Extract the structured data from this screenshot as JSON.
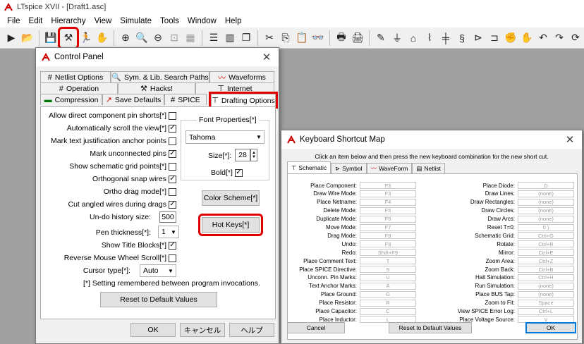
{
  "app": {
    "title": "LTspice XVII - [Draft1.asc]"
  },
  "menu": [
    "File",
    "Edit",
    "Hierarchy",
    "View",
    "Simulate",
    "Tools",
    "Window",
    "Help"
  ],
  "toolbar_icons": [
    "run-icon",
    "open-icon",
    "save-icon",
    "control-panel-icon",
    "running-man-icon",
    "hand-icon",
    "zoom-in-icon",
    "zoom-pan-icon",
    "zoom-out-icon",
    "zoom-fit-icon",
    "tile-horizontal-icon",
    "tile-vertical-icon",
    "cascade-icon",
    "cut-icon",
    "copy-icon",
    "paste-icon",
    "find-icon",
    "print-setup-icon",
    "print-icon",
    "pencil-wire-icon",
    "ground-icon",
    "label-icon",
    "resistor-icon",
    "capacitor-icon",
    "inductor-icon",
    "diode-icon",
    "component-icon",
    "move-icon",
    "drag-icon",
    "undo-icon",
    "redo-icon"
  ],
  "control_panel": {
    "title": "Control Panel",
    "tabs_row1": [
      {
        "label": "Netlist Options",
        "icon": "#"
      },
      {
        "label": "Sym. & Lib. Search Paths",
        "icon": "🔍"
      },
      {
        "label": "Waveforms",
        "icon": "~"
      }
    ],
    "tabs_row2": [
      {
        "label": "Operation",
        "icon": "#"
      },
      {
        "label": "Hacks!",
        "icon": "⚒"
      },
      {
        "label": "Internet",
        "icon": "⊤"
      }
    ],
    "tabs_row3": [
      {
        "label": "Compression",
        "icon": "▬"
      },
      {
        "label": "Save Defaults",
        "icon": "↗"
      },
      {
        "label": "SPICE",
        "icon": "#"
      },
      {
        "label": "Drafting Options",
        "icon": "⊤"
      }
    ],
    "options": [
      {
        "label": "Allow direct component pin shorts[*]",
        "checked": false
      },
      {
        "label": "Automatically scroll the view[*]",
        "checked": true
      },
      {
        "label": "Mark text justification anchor points",
        "checked": false
      },
      {
        "label": "Mark unconnected pins",
        "checked": true
      },
      {
        "label": "Show schematic grid points[*]",
        "checked": false
      },
      {
        "label": "Orthogonal snap wires",
        "checked": true
      },
      {
        "label": "Ortho drag mode[*]",
        "checked": false
      },
      {
        "label": "Cut angled wires during drags",
        "checked": true
      }
    ],
    "undo_label": "Un-do history size:",
    "undo_value": "500",
    "pen_label": "Pen thickness[*]:",
    "pen_value": "1",
    "show_title_blocks": {
      "label": "Show Title Blocks[*]",
      "checked": true
    },
    "reverse_scroll": {
      "label": "Reverse Mouse Wheel Scroll[*]",
      "checked": false
    },
    "cursor_label": "Cursor type[*]:",
    "cursor_value": "Auto",
    "font_group": "Font Properties[*]",
    "font_name": "Tahoma",
    "size_label": "Size[*]:",
    "size_value": "28",
    "bold_label": "Bold[*]",
    "color_scheme": "Color Scheme[*]",
    "hot_keys": "Hot Keys[*]",
    "note": "[*] Setting remembered between program invocations.",
    "reset": "Reset to Default Values",
    "ok": "OK",
    "cancel": "キャンセル",
    "help": "ヘルプ"
  },
  "shortcut_map": {
    "title": "Keyboard Shortcut Map",
    "hint": "Click an item below and then press the new keyboard combination for the new short cut.",
    "tabs": [
      "Schematic",
      "Symbol",
      "WaveForm",
      "Netlist"
    ],
    "left": [
      {
        "label": "Place Component:",
        "key": "F3"
      },
      {
        "label": "Draw Wire Mode:",
        "key": "F3"
      },
      {
        "label": "Place Netname:",
        "key": "F4"
      },
      {
        "label": "Delete Mode:",
        "key": "F5"
      },
      {
        "label": "Duplicate Mode:",
        "key": "F6"
      },
      {
        "label": "Move Mode:",
        "key": "F7"
      },
      {
        "label": "Drag Mode:",
        "key": "F8"
      },
      {
        "label": "Undo:",
        "key": "F9"
      },
      {
        "label": "Redo:",
        "key": "Shift+F9"
      },
      {
        "label": "Place Comment Text:",
        "key": "T"
      },
      {
        "label": "Place SPICE Directive:",
        "key": "S"
      },
      {
        "label": "Unconn. Pin Marks:",
        "key": "U"
      },
      {
        "label": "Text Anchor Marks:",
        "key": "A"
      },
      {
        "label": "Place Ground:",
        "key": "G"
      },
      {
        "label": "Place Resistor:",
        "key": "R"
      },
      {
        "label": "Place Capacitor:",
        "key": "C"
      },
      {
        "label": "Place Inductor:",
        "key": "L"
      }
    ],
    "right": [
      {
        "label": "Place Diode:",
        "key": "D"
      },
      {
        "label": "Draw Lines:",
        "key": "(none)"
      },
      {
        "label": "Draw Rectangles:",
        "key": "(none)"
      },
      {
        "label": "Draw Circles:",
        "key": "(none)"
      },
      {
        "label": "Draw Arcs:",
        "key": "(none)"
      },
      {
        "label": "Reset T=0:",
        "key": "0 )"
      },
      {
        "label": "Schematic Grid:",
        "key": "Ctrl+G"
      },
      {
        "label": "Rotate:",
        "key": "Ctrl+R"
      },
      {
        "label": "Mirror:",
        "key": "Ctrl+E"
      },
      {
        "label": "Zoom Area:",
        "key": "Ctrl+Z"
      },
      {
        "label": "Zoom Back:",
        "key": "Ctrl+B"
      },
      {
        "label": "Halt Simulation:",
        "key": "Ctrl+H"
      },
      {
        "label": "Run Simulation:",
        "key": "(none)"
      },
      {
        "label": "Place BUS Tap:",
        "key": "(none)"
      },
      {
        "label": "Zoom to Fit:",
        "key": "Space"
      },
      {
        "label": "View SPICE Error Log:",
        "key": "Ctrl+L"
      },
      {
        "label": "Place Voltage Source:",
        "key": "V"
      }
    ],
    "cancel": "Cancel",
    "reset": "Reset to Default Values",
    "ok": "OK"
  }
}
